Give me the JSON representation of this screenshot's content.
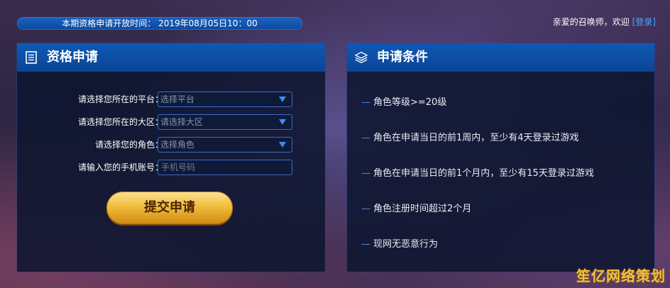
{
  "header": {
    "open_time_text": "本期资格申请开放时间： 2019年08月05日10：00",
    "welcome_text": "亲爱的召唤师，欢迎",
    "login_link": "[登录]"
  },
  "application": {
    "title": "资格申请",
    "icon": "document-icon",
    "fields": [
      {
        "label": "请选择您所在的平台：",
        "value": "选择平台",
        "type": "select"
      },
      {
        "label": "请选择您所在的大区：",
        "value": "请选择大区",
        "type": "select"
      },
      {
        "label": "请选择您的角色：",
        "value": "选择角色",
        "type": "select"
      },
      {
        "label": "请输入您的手机账号：",
        "placeholder": "手机号码",
        "type": "input"
      }
    ],
    "submit_label": "提交申请"
  },
  "conditions": {
    "title": "申请条件",
    "icon": "layers-icon",
    "items": [
      "角色等级>=20级",
      "角色在申请当日的前1周内，至少有4天登录过游戏",
      "角色在申请当日的前1个月内，至少有15天登录过游戏",
      "角色注册时间超过2个月",
      "现网无恶意行为"
    ]
  },
  "watermark": "笙亿网络策划",
  "colors": {
    "accent_blue": "#0f59b3",
    "gold": "#f1bd3c",
    "link": "#4aa8ff"
  }
}
